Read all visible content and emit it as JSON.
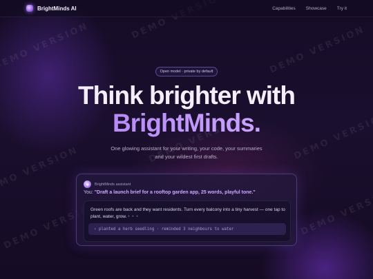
{
  "nav": {
    "brand": "BrightMinds AI",
    "links": [
      "Capabilities",
      "Showcase",
      "Try it"
    ]
  },
  "watermark": "DEMO VERSION",
  "hero": {
    "pill": "Open model · private by default",
    "headline_1": "Think brighter with",
    "headline_2": "BrightMinds.",
    "subtitle_1": "One glowing assistant for your writing, your code, your summaries",
    "subtitle_2": "and your wildest first drafts."
  },
  "demo": {
    "assistant_label": "BrightMinds assistant",
    "user_prefix": "You:",
    "prompt": "\"Draft a launch brief for a rooftop garden app, 25 words, playful tone.\"",
    "response": "Green roofs are back and they want residents. Turn every balcony into a tiny harvest — one tap to plant, water, grow.",
    "typing_dots": "• • •",
    "log": "› planted a herb seedling · reminded 3 neighbours to water"
  },
  "colors": {
    "background": "#150c27",
    "accent": "#b58aff",
    "accent_deep": "#9a62f0"
  },
  "icons": {
    "logo": "brightminds-logo-icon",
    "assistant": "spark-icon"
  }
}
